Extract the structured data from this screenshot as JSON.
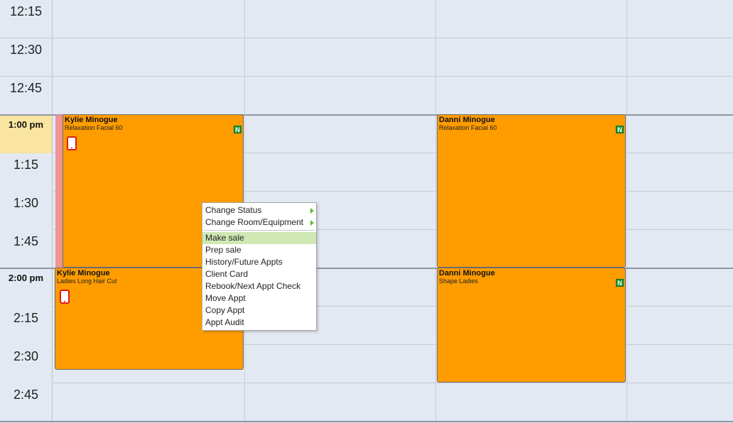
{
  "time_slots": [
    {
      "label": "12:15",
      "kind": "quarter"
    },
    {
      "label": "12:30",
      "kind": "quarter"
    },
    {
      "label": "12:45",
      "kind": "quarter"
    },
    {
      "label": "1:00 pm",
      "kind": "hour",
      "current": true
    },
    {
      "label": "1:15",
      "kind": "quarter"
    },
    {
      "label": "1:30",
      "kind": "quarter"
    },
    {
      "label": "1:45",
      "kind": "quarter"
    },
    {
      "label": "2:00 pm",
      "kind": "hour"
    },
    {
      "label": "2:15",
      "kind": "quarter"
    },
    {
      "label": "2:30",
      "kind": "quarter"
    },
    {
      "label": "2:45",
      "kind": "quarter"
    }
  ],
  "appointments": [
    {
      "client": "Kylie Minogue",
      "service": "Relaxation Facial 60",
      "badge": "N",
      "phone_icon": "mobile-phone-icon"
    },
    {
      "client": "Kylie Minogue",
      "service": "Ladies Long Hair Cut",
      "badge": "",
      "phone_icon": "mobile-phone-icon"
    },
    {
      "client": "Danni Minogue",
      "service": "Relaxation Facial 60",
      "badge": "N",
      "phone_icon": ""
    },
    {
      "client": "Danni Minogue",
      "service": "Shape Ladies",
      "badge": "N",
      "phone_icon": ""
    }
  ],
  "context_menu": {
    "items": [
      {
        "label": "Change Status",
        "submenu": true
      },
      {
        "label": "Change Room/Equipment",
        "submenu": true
      },
      {
        "label": "Make sale",
        "active": true
      },
      {
        "label": "Prep sale"
      },
      {
        "label": "History/Future Appts"
      },
      {
        "label": "Client Card"
      },
      {
        "label": "Rebook/Next Appt Check"
      },
      {
        "label": "Move Appt"
      },
      {
        "label": "Copy Appt"
      },
      {
        "label": "Appt Audit"
      }
    ]
  },
  "colors": {
    "appointment": "#ff9c00",
    "current_time": "#f9e4a0",
    "highlight": "#cfe8b4",
    "badge": "#1f9b3a"
  }
}
